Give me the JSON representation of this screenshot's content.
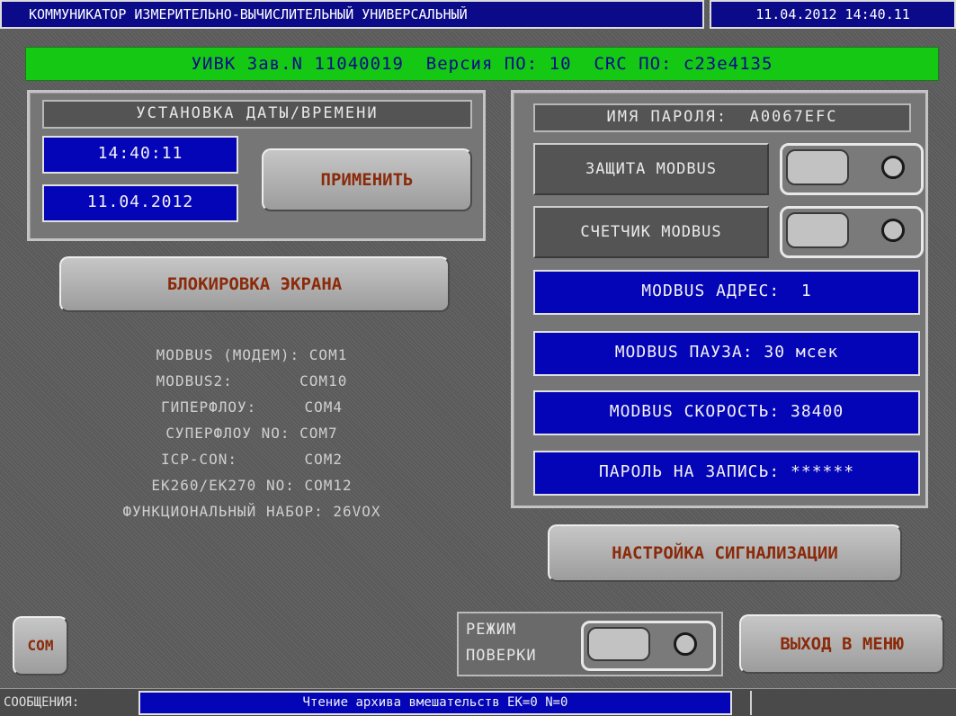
{
  "header": {
    "title": "КОММУНИКАТОР ИЗМЕРИТЕЛЬНО-ВЫЧИСЛИТЕЛЬНЫЙ УНИВЕРСАЛЬНЫЙ",
    "datetime": "11.04.2012 14:40.11"
  },
  "device_bar": {
    "text": "УИВК Зав.N 11040019  Версия ПО: 10  CRC ПО: c23e4135"
  },
  "date_time_panel": {
    "header": "УСТАНОВКА ДАТЫ/ВРЕМЕНИ",
    "time_value": "14:40:11",
    "date_value": "11.04.2012",
    "apply_label": "ПРИМЕНИТЬ"
  },
  "screen_lock": {
    "label": "БЛОКИРОВКА ЭКРАНА"
  },
  "port_info": [
    "MODBUS (МОДЕМ): COM1",
    "MODBUS2:       COM10",
    "ГИПЕРФЛОУ:     COM4",
    "СУПЕРФЛОУ NO: COM7",
    "ICP-CON:       COM2",
    "EK260/EK270 NO: COM12",
    "ФУНКЦИОНАЛЬНЫЙ НАБОР: 26VOX"
  ],
  "modbus_panel": {
    "password_name": "ИМЯ ПАРОЛЯ:  A0067EFC",
    "protection_label": "ЗАЩИТА MODBUS",
    "counter_label": "СЧЕТЧИК MODBUS",
    "address": "MODBUS АДРЕС:  1",
    "pause": "MODBUS ПАУЗА: 30 мсек",
    "speed": "MODBUS СКОРОСТЬ: 38400",
    "write_password": "ПАРОЛЬ НА ЗАПИСЬ: ******"
  },
  "alarm_button": {
    "label": "НАСТРОЙКА СИГНАЛИЗАЦИИ"
  },
  "verification_mode": {
    "label_line1": "РЕЖИМ",
    "label_line2": "ПОВЕРКИ"
  },
  "com_button": {
    "label": "COM"
  },
  "exit_button": {
    "label": "ВЫХОД В МЕНЮ"
  },
  "status": {
    "label": "СООБЩЕНИЯ:",
    "message": "Чтение архива вмешательств EK=0 N=0"
  },
  "colors": {
    "title_blue": "#0b0b8a",
    "device_green": "#14c814",
    "value_blue": "#0505b8",
    "button_text": "#8a2a0a"
  }
}
